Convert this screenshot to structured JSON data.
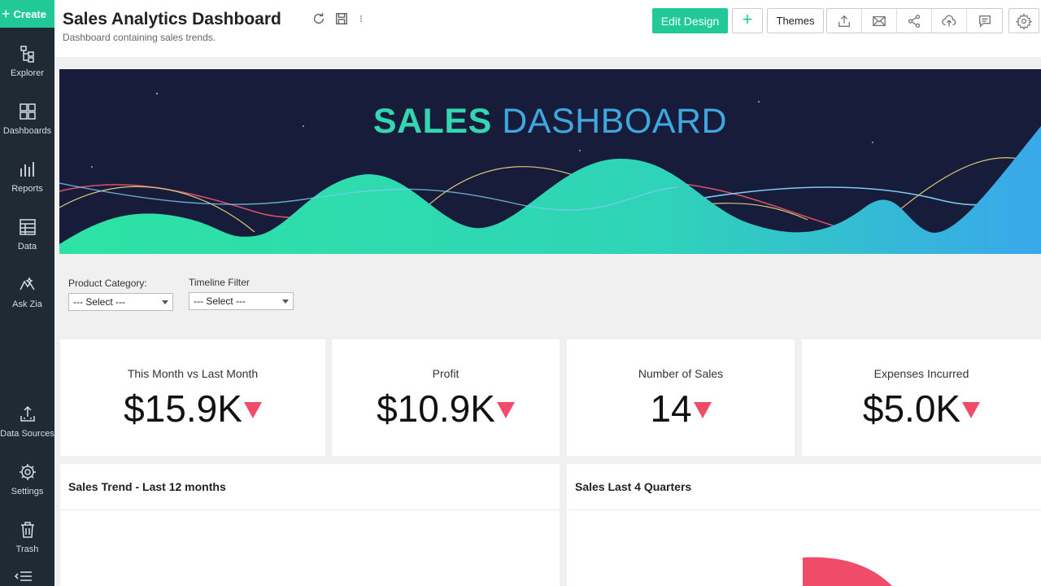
{
  "sidebar": {
    "create_label": "Create",
    "items": [
      {
        "label": "Explorer",
        "icon": "explorer-icon"
      },
      {
        "label": "Dashboards",
        "icon": "dashboards-icon"
      },
      {
        "label": "Reports",
        "icon": "reports-icon"
      },
      {
        "label": "Data",
        "icon": "data-icon"
      },
      {
        "label": "Ask Zia",
        "icon": "ask-zia-icon"
      },
      {
        "label": "Data Sources",
        "icon": "data-sources-icon"
      },
      {
        "label": "Settings",
        "icon": "settings-icon"
      },
      {
        "label": "Trash",
        "icon": "trash-icon"
      }
    ]
  },
  "header": {
    "title": "Sales Analytics Dashboard",
    "subtitle": "Dashboard containing sales trends.",
    "edit_design_label": "Edit Design",
    "plus_label": "+",
    "themes_label": "Themes"
  },
  "banner": {
    "word1": "SALES",
    "word2": "DASHBOARD"
  },
  "filters": [
    {
      "label": "Product Category:",
      "value": "--- Select ---"
    },
    {
      "label": "Timeline Filter",
      "value": "--- Select ---"
    }
  ],
  "kpis": [
    {
      "title": "This Month vs Last Month",
      "value": "$15.9K",
      "trend": "down"
    },
    {
      "title": "Profit",
      "value": "$10.9K",
      "trend": "down"
    },
    {
      "title": "Number of Sales",
      "value": "14",
      "trend": "down"
    },
    {
      "title": "Expenses Incurred",
      "value": "$5.0K",
      "trend": "down"
    }
  ],
  "panels": [
    {
      "title": "Sales Trend - Last 12 months"
    },
    {
      "title": "Sales Last 4 Quarters"
    }
  ],
  "colors": {
    "accent": "#20c997",
    "sidebar": "#1f2a35",
    "down": "#ef4c6a",
    "banner_bg": "#161c3a",
    "banner_teal": "#33d6b0",
    "banner_blue": "#3fa7e0"
  }
}
